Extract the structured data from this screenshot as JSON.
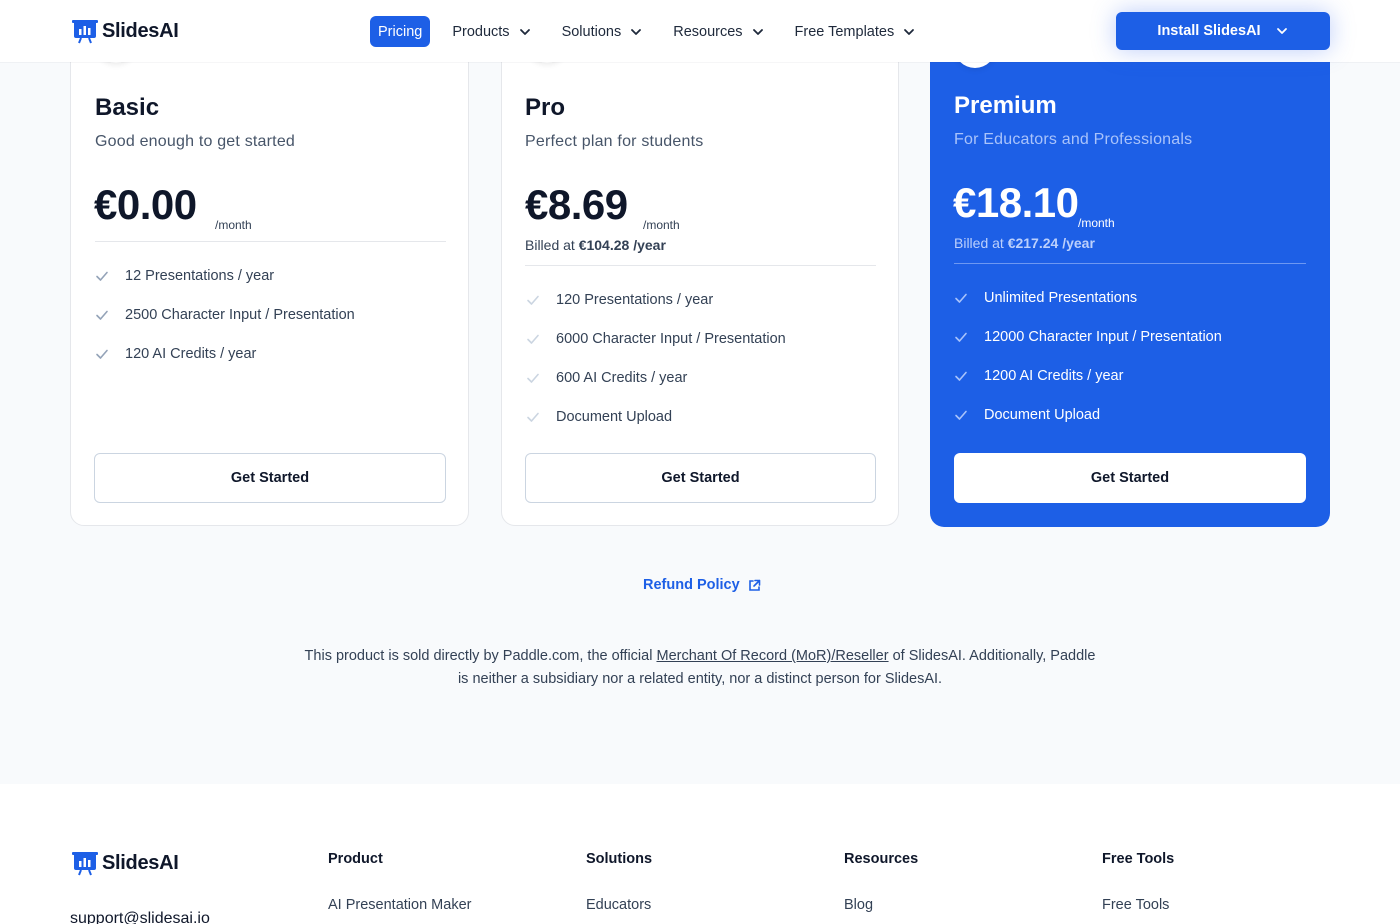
{
  "header": {
    "logo_text": "SlidesAI",
    "nav": [
      {
        "label": "Pricing",
        "active": true
      },
      {
        "label": "Products"
      },
      {
        "label": "Solutions"
      },
      {
        "label": "Resources"
      },
      {
        "label": "Free Templates"
      }
    ],
    "install_label": "Install SlidesAI"
  },
  "plans": {
    "basic": {
      "title": "Basic",
      "subtitle": "Good enough to get started",
      "price": "€0.00",
      "per": "/month",
      "features": [
        "12 Presentations / year",
        "2500 Character Input / Presentation",
        "120 AI Credits / year"
      ],
      "cta": "Get Started"
    },
    "pro": {
      "title": "Pro",
      "subtitle": "Perfect plan for students",
      "price": "€8.69",
      "per": "/month",
      "billed_prefix": "Billed at",
      "billed_amount": "€104.28 /year",
      "features": [
        "120 Presentations / year",
        "6000 Character Input / Presentation",
        "600 AI Credits / year",
        "Document Upload"
      ],
      "cta": "Get Started"
    },
    "premium": {
      "title": "Premium",
      "subtitle": "For Educators and Professionals",
      "price": "€18.10",
      "per": "/month",
      "billed_prefix": "Billed at",
      "billed_amount": "€217.24 /year",
      "features": [
        "Unlimited Presentations",
        "12000 Character Input / Presentation",
        "1200 AI Credits / year",
        "Document Upload"
      ],
      "cta": "Get Started"
    }
  },
  "refund_label": "Refund Policy",
  "disclaimer": {
    "part1": "This product is sold directly by Paddle.com, the official",
    "link": "Merchant Of Record (MoR)/Reseller",
    "part2": "of SlidesAI. Additionally, Paddle is neither a subsidiary nor a related entity, nor a distinct person for SlidesAI."
  },
  "footer": {
    "logo_text": "SlidesAI",
    "email": "support@slidesai.io",
    "columns": [
      {
        "heading": "Product",
        "first_item": "AI Presentation Maker"
      },
      {
        "heading": "Solutions",
        "first_item": "Educators"
      },
      {
        "heading": "Resources",
        "first_item": "Blog"
      },
      {
        "heading": "Free Tools",
        "first_item": "Free Tools"
      }
    ]
  },
  "colors": {
    "brand": "#1d5fe6",
    "text": "#0f172a",
    "muted": "#475569"
  }
}
